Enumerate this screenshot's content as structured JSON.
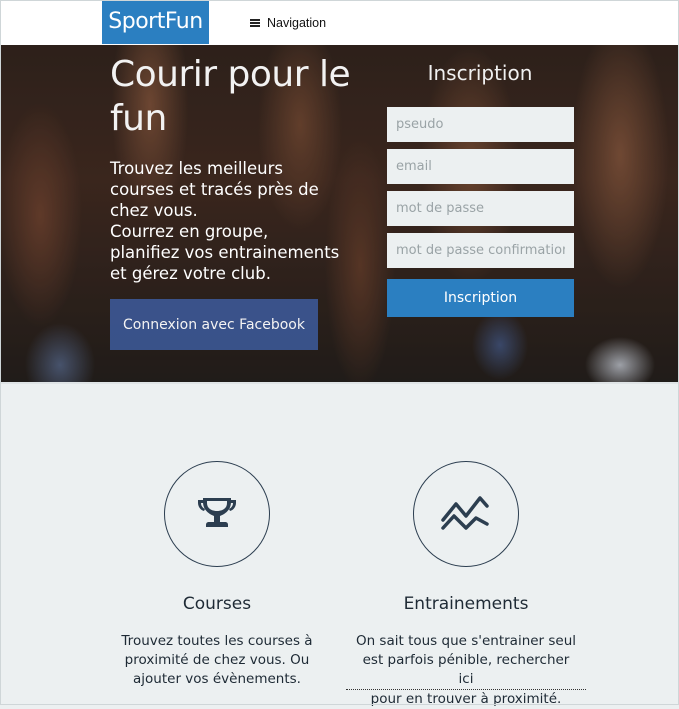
{
  "navbar": {
    "brand": "SportFun",
    "nav_label": "Navigation",
    "menu_icon": "hamburger-icon"
  },
  "hero": {
    "title": "Courir pour le fun",
    "lines": [
      "Trouvez les meilleurs",
      "courses et tracés près de",
      "chez vous.",
      "Courrez en groupe,",
      "planifiez vos entrainements",
      "et gérez votre club."
    ],
    "facebook_button": "Connexion avec Facebook"
  },
  "signup": {
    "title": "Inscription",
    "pseudo_placeholder": "pseudo",
    "email_placeholder": "email",
    "password_placeholder": "mot de passe",
    "password_confirm_placeholder": "mot de passe confirmation",
    "submit_label": "Inscription"
  },
  "features": [
    {
      "icon": "trophy-icon",
      "title": "Courses",
      "lines": [
        "Trouvez toutes les courses à",
        "proximité de chez vous. Ou",
        "ajouter vos évènements."
      ]
    },
    {
      "icon": "chart-line-icon",
      "title": "Entrainements",
      "lines": [
        "On sait tous que s'entrainer seul",
        "est parfois pénible, rechercher ",
        "pour en trouver à proximité."
      ],
      "link_text": "ici"
    }
  ],
  "colors": {
    "brand_blue": "#2b7fc1",
    "facebook_blue": "#3b5590",
    "light_bg": "#ecf0f1",
    "dark_text": "#1e2a35"
  }
}
